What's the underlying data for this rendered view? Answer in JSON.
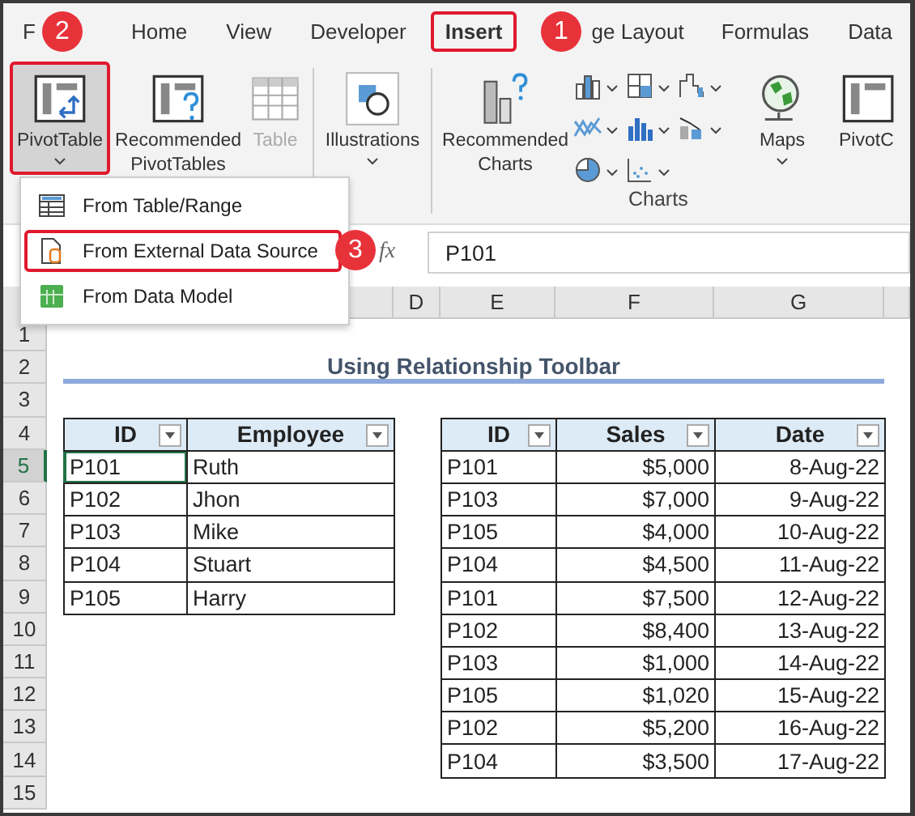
{
  "ribbon_tabs": [
    {
      "label": "F",
      "selected": false,
      "outlined": false
    },
    {
      "label": "Home",
      "selected": false,
      "outlined": false
    },
    {
      "label": "View",
      "selected": false,
      "outlined": false
    },
    {
      "label": "Developer",
      "selected": false,
      "outlined": false
    },
    {
      "label": "Insert",
      "selected": true,
      "outlined": true
    },
    {
      "label": "ge Layout",
      "selected": false,
      "outlined": false
    },
    {
      "label": "Formulas",
      "selected": false,
      "outlined": false
    },
    {
      "label": "Data",
      "selected": false,
      "outlined": false
    }
  ],
  "ribbon": {
    "buttons": [
      {
        "kind": "pivot",
        "label": "PivotTable",
        "pressed": true,
        "disabled": false
      },
      {
        "kind": "recommended-pivot",
        "label": "Recommended PivotTables",
        "pressed": false,
        "disabled": false
      },
      {
        "kind": "table",
        "label": "Table",
        "pressed": false,
        "disabled": true
      },
      {
        "kind": "illustrations",
        "label": "Illustrations",
        "pressed": false,
        "disabled": false
      },
      {
        "kind": "recommended-charts",
        "label": "Recommended Charts",
        "pressed": false,
        "disabled": false
      },
      {
        "kind": "maps",
        "label": "Maps",
        "pressed": false,
        "disabled": false
      },
      {
        "kind": "pivotchart",
        "label": "PivotC",
        "pressed": false,
        "disabled": false
      }
    ],
    "group_label": "Charts"
  },
  "pivot_menu": [
    {
      "label": "From Table/Range",
      "kind": "table",
      "outlined": false
    },
    {
      "label": "From External Data Source",
      "kind": "external",
      "outlined": true
    },
    {
      "label": "From Data Model",
      "kind": "model",
      "outlined": false
    }
  ],
  "callouts": [
    {
      "number": "1"
    },
    {
      "number": "2"
    },
    {
      "number": "3"
    }
  ],
  "formula_bar": {
    "fx": "fx",
    "value": "P101"
  },
  "column_headers": [
    "D",
    "E",
    "F",
    "G"
  ],
  "row_numbers": [
    {
      "label": "1",
      "selected": false
    },
    {
      "label": "2",
      "selected": false
    },
    {
      "label": "3",
      "selected": false
    },
    {
      "label": "4",
      "selected": false
    },
    {
      "label": "5",
      "selected": true
    },
    {
      "label": "6",
      "selected": false
    },
    {
      "label": "7",
      "selected": false
    },
    {
      "label": "8",
      "selected": false
    },
    {
      "label": "9",
      "selected": false
    },
    {
      "label": "10",
      "selected": false
    },
    {
      "label": "11",
      "selected": false
    },
    {
      "label": "12",
      "selected": false
    },
    {
      "label": "13",
      "selected": false
    },
    {
      "label": "14",
      "selected": false
    },
    {
      "label": "15",
      "selected": false
    }
  ],
  "sheet_title": "Using Relationship Toolbar",
  "employee_table": {
    "columns": [
      "ID",
      "Employee"
    ],
    "rows": [
      {
        "id": "P101",
        "employee": "Ruth",
        "selected": true
      },
      {
        "id": "P102",
        "employee": "Jhon",
        "selected": false
      },
      {
        "id": "P103",
        "employee": "Mike",
        "selected": false
      },
      {
        "id": "P104",
        "employee": "Stuart",
        "selected": false
      },
      {
        "id": "P105",
        "employee": "Harry",
        "selected": false
      }
    ]
  },
  "sales_table": {
    "columns": [
      "ID",
      "Sales",
      "Date"
    ],
    "rows": [
      {
        "id": "P101",
        "sales": "$5,000",
        "date": "8-Aug-22"
      },
      {
        "id": "P103",
        "sales": "$7,000",
        "date": "9-Aug-22"
      },
      {
        "id": "P105",
        "sales": "$4,000",
        "date": "10-Aug-22"
      },
      {
        "id": "P104",
        "sales": "$4,500",
        "date": "11-Aug-22"
      },
      {
        "id": "P101",
        "sales": "$7,500",
        "date": "12-Aug-22"
      },
      {
        "id": "P102",
        "sales": "$8,400",
        "date": "13-Aug-22"
      },
      {
        "id": "P103",
        "sales": "$1,000",
        "date": "14-Aug-22"
      },
      {
        "id": "P105",
        "sales": "$1,020",
        "date": "15-Aug-22"
      },
      {
        "id": "P102",
        "sales": "$5,200",
        "date": "16-Aug-22"
      },
      {
        "id": "P104",
        "sales": "$3,500",
        "date": "17-Aug-22"
      }
    ]
  }
}
